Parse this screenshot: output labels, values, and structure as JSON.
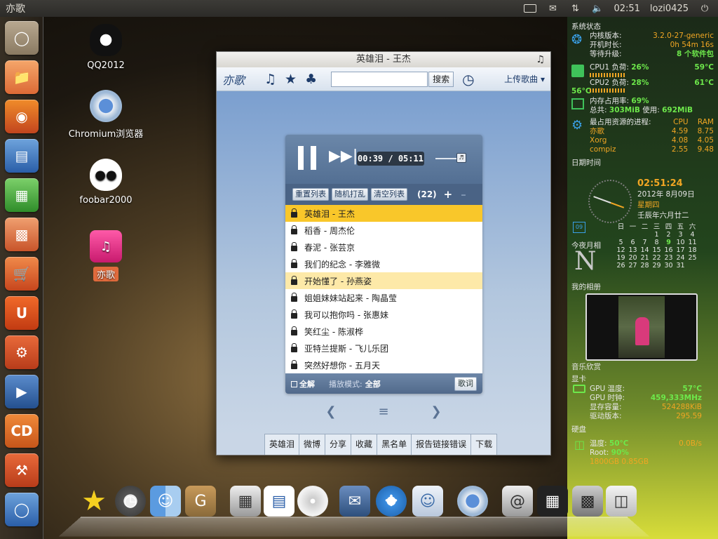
{
  "top_panel": {
    "app_name": "亦歌",
    "time": "02:51",
    "user": "lozi0425",
    "tray_icons": [
      "keyboard-icon",
      "mail-icon",
      "network-icon",
      "volume-icon"
    ]
  },
  "launcher": {
    "items": [
      "ubuntu-home",
      "files",
      "firefox",
      "writer",
      "calc",
      "impress",
      "software-center",
      "ubuntu-one",
      "system-settings",
      "media-player",
      "cd-burner",
      "system-tools",
      "chromium"
    ]
  },
  "desktop": {
    "icons": [
      {
        "label": "QQ2012"
      },
      {
        "label": "Chromium浏览器"
      },
      {
        "label": "foobar2000"
      },
      {
        "label": "亦歌"
      }
    ]
  },
  "player": {
    "title": "英雄泪 - 王杰",
    "brand": "亦歌",
    "search_placeholder": "",
    "search_button": "搜索",
    "upload_button": "上传歌曲",
    "time_display": "00:39 / 05:11",
    "volume_level": 1.0,
    "list_buttons": [
      "重置列表",
      "随机打乱",
      "清空列表"
    ],
    "count": "(22)",
    "tracks": [
      "英雄泪 - 王杰",
      "稻香 - 周杰伦",
      "春泥 - 张芸京",
      "我们的纪念 - 李雅微",
      "开始懂了 - 孙燕姿",
      "姐姐妹妹站起来 - 陶晶莹",
      "我可以抱你吗 - 张惠妹",
      "笑红尘 - 陈淑桦",
      "亚特兰提斯 - 飞儿乐团",
      "突然好想你 - 五月天"
    ],
    "playing_index": 0,
    "hover_index": 4,
    "unlock_all": "全解",
    "mode_label": "播放模式:",
    "mode_value": "全部",
    "lyrics_button": "歌词",
    "bottom_tabs": [
      "英雄泪",
      "微博",
      "分享",
      "收藏",
      "黑名单",
      "报告链接错误",
      "下载"
    ]
  },
  "sidebar": {
    "system_status_title": "系统状态",
    "kernel_label": "内核版本:",
    "kernel_value": "3.2.0-27-generic",
    "uptime_label": "开机时长:",
    "uptime_value": "0h 54m 16s",
    "updates_label": "等待升级:",
    "updates_value": "8 个软件包",
    "cpu1_label": "CPU1 负荷:",
    "cpu1_load": "26%",
    "cpu1_temp": "59°C",
    "cpu2_label": "CPU2 负荷:",
    "cpu2_load": "28%",
    "cpu2_temp": "61°C",
    "cpu_temp": "56°C",
    "mem_label": "内存占用率:",
    "mem_value": "69%",
    "mem_total_label": "总共:",
    "mem_total": "303MiB",
    "mem_used_label": "使用:",
    "mem_used": "692MiB",
    "proc_title": "最占用资源的进程:",
    "proc_cpu_header": "CPU",
    "proc_ram_header": "RAM",
    "processes": [
      {
        "name": "亦歌",
        "cpu": "4.59",
        "ram": "8.75"
      },
      {
        "name": "Xorg",
        "cpu": "4.08",
        "ram": "4.05"
      },
      {
        "name": "compiz",
        "cpu": "2.55",
        "ram": "9.48"
      }
    ],
    "datetime_title": "日期时间",
    "clock": "02:51:24",
    "date": "2012年  8月09日",
    "weekday": "星期四",
    "lunar": "壬辰年六月廿二",
    "calendar_badge": "09",
    "calendar_header": [
      "日",
      "一",
      "二",
      "三",
      "四",
      "五",
      "六"
    ],
    "calendar_rows": [
      [
        "",
        "",
        "",
        "1",
        "2",
        "3",
        "4"
      ],
      [
        "5",
        "6",
        "7",
        "8",
        "9",
        "10",
        "11"
      ],
      [
        "12",
        "13",
        "14",
        "15",
        "16",
        "17",
        "18"
      ],
      [
        "19",
        "20",
        "21",
        "22",
        "23",
        "24",
        "25"
      ],
      [
        "26",
        "27",
        "28",
        "29",
        "30",
        "31",
        ""
      ]
    ],
    "moon_title": "今夜月相",
    "moon_letter": "N",
    "album_title": "我的相册",
    "music_title": "音乐欣赏",
    "gpu_title": "显卡",
    "gpu_temp_label": "GPU 温度:",
    "gpu_temp": "57°C",
    "gpu_clock_label": "GPU 时钟:",
    "gpu_clock": "459,333MHz",
    "gpu_mem_label": "显存容量:",
    "gpu_mem": "524288KiB",
    "gpu_driver_label": "驱动版本:",
    "gpu_driver": "295.59",
    "disk_title": "硬盘",
    "disk_temp_label": "温度:",
    "disk_temp": "50°C",
    "disk_root_label": "Root:",
    "disk_root": "90%",
    "disk_f": "1800GB",
    "disk_u": "0.85GB",
    "disk_speed": "0.0B/s"
  }
}
